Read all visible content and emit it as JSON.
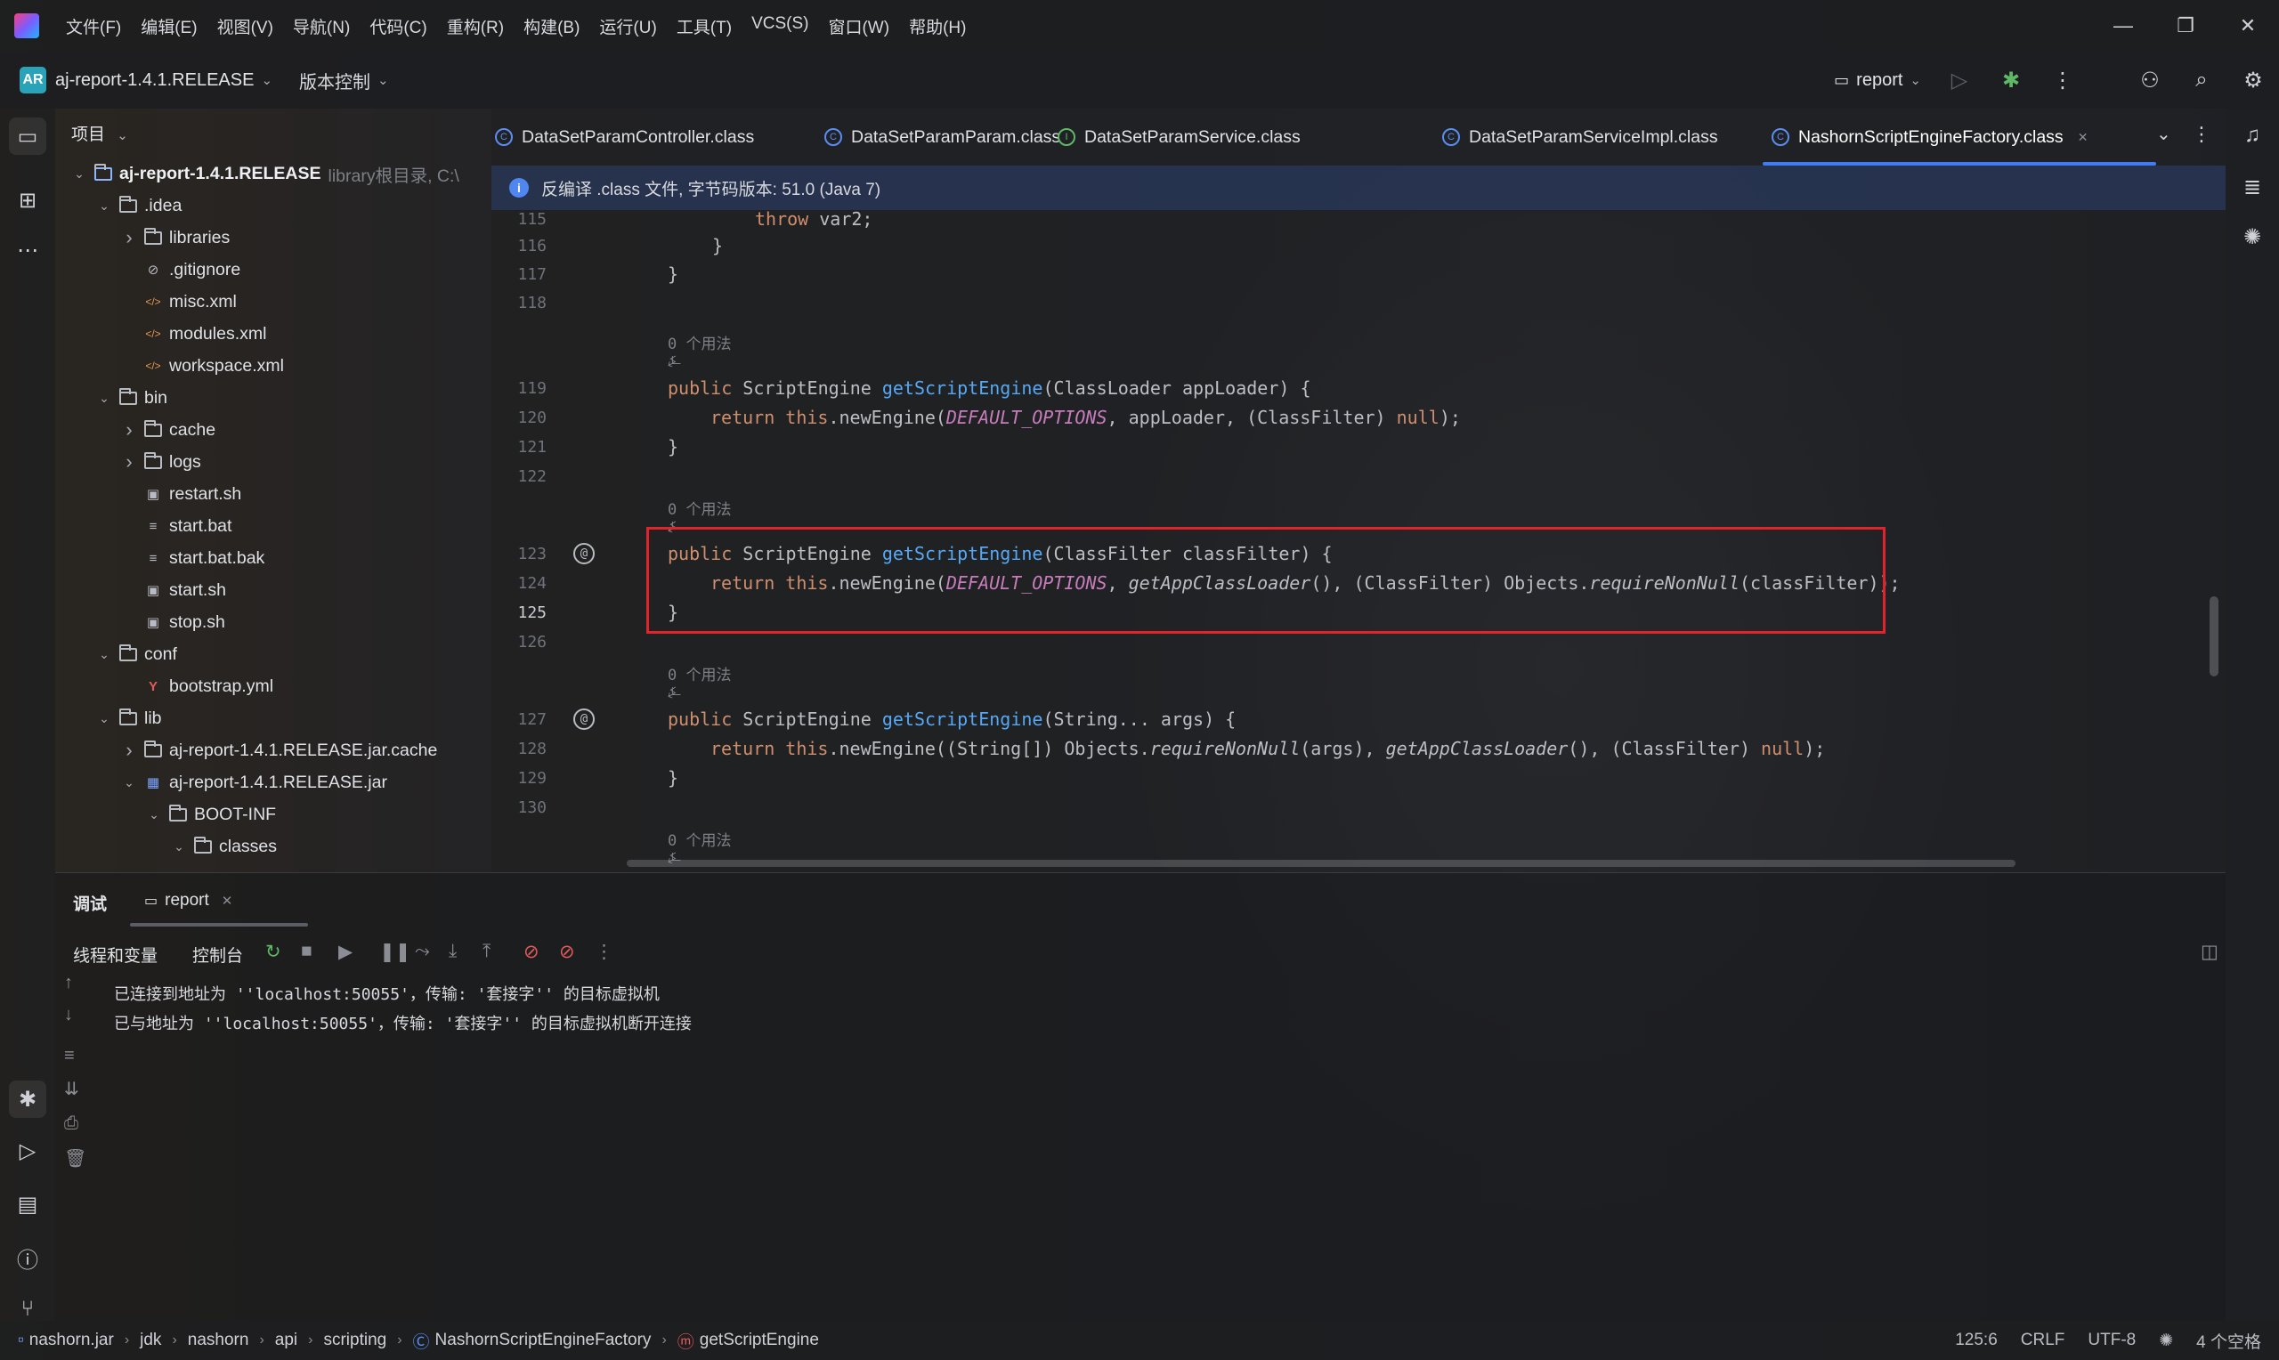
{
  "menu": [
    "文件(F)",
    "编辑(E)",
    "视图(V)",
    "导航(N)",
    "代码(C)",
    "重构(R)",
    "构建(B)",
    "运行(U)",
    "工具(T)",
    "VCS(S)",
    "窗口(W)",
    "帮助(H)"
  ],
  "toolbar": {
    "project_badge": "AR",
    "project_name": "aj-report-1.4.1.RELEASE",
    "vcs_label": "版本控制",
    "run_config": "report"
  },
  "project_panel": {
    "header": "项目",
    "tree": [
      {
        "label": "aj-report-1.4.1.RELEASE",
        "hint": "library根目录, C:\\",
        "arrow": "v",
        "icon": "module",
        "depth": 0,
        "bold": true
      },
      {
        "label": ".idea",
        "arrow": "v",
        "icon": "folder",
        "depth": 1
      },
      {
        "label": "libraries",
        "arrow": ">",
        "icon": "folder",
        "depth": 2
      },
      {
        "label": ".gitignore",
        "arrow": "",
        "icon": "ignore",
        "depth": 2
      },
      {
        "label": "misc.xml",
        "arrow": "",
        "icon": "xml",
        "depth": 2
      },
      {
        "label": "modules.xml",
        "arrow": "",
        "icon": "xml",
        "depth": 2
      },
      {
        "label": "workspace.xml",
        "arrow": "",
        "icon": "xml",
        "depth": 2
      },
      {
        "label": "bin",
        "arrow": "v",
        "icon": "folder",
        "depth": 1
      },
      {
        "label": "cache",
        "arrow": ">",
        "icon": "folder",
        "depth": 2
      },
      {
        "label": "logs",
        "arrow": ">",
        "icon": "folder",
        "depth": 2
      },
      {
        "label": "restart.sh",
        "arrow": "",
        "icon": "shell",
        "depth": 2
      },
      {
        "label": "start.bat",
        "arrow": "",
        "icon": "text",
        "depth": 2
      },
      {
        "label": "start.bat.bak",
        "arrow": "",
        "icon": "text",
        "depth": 2
      },
      {
        "label": "start.sh",
        "arrow": "",
        "icon": "shell",
        "depth": 2
      },
      {
        "label": "stop.sh",
        "arrow": "",
        "icon": "shell",
        "depth": 2
      },
      {
        "label": "conf",
        "arrow": "v",
        "icon": "folder",
        "depth": 1
      },
      {
        "label": "bootstrap.yml",
        "arrow": "",
        "icon": "yaml",
        "depth": 2
      },
      {
        "label": "lib",
        "arrow": "v",
        "icon": "folder",
        "depth": 1
      },
      {
        "label": "aj-report-1.4.1.RELEASE.jar.cache",
        "arrow": ">",
        "icon": "folder",
        "depth": 2
      },
      {
        "label": "aj-report-1.4.1.RELEASE.jar",
        "arrow": "v",
        "icon": "jar",
        "depth": 2
      },
      {
        "label": "BOOT-INF",
        "arrow": "v",
        "icon": "folder",
        "depth": 3
      },
      {
        "label": "classes",
        "arrow": "v",
        "icon": "folder",
        "depth": 4
      }
    ]
  },
  "tabs": [
    {
      "label": "DataSetParamController.class",
      "icon": "class",
      "active": false
    },
    {
      "label": "DataSetParamParam.class",
      "icon": "class",
      "active": false
    },
    {
      "label": "DataSetParamService.class",
      "icon": "interface",
      "active": false
    },
    {
      "label": "DataSetParamServiceImpl.class",
      "icon": "class",
      "active": false
    },
    {
      "label": "NashornScriptEngineFactory.class",
      "icon": "class",
      "active": true
    }
  ],
  "info_bar": "反编译 .class 文件, 字节码版本: 51.0 (Java 7)",
  "code": {
    "usage_hint": "0 个用法",
    "author_hint": "⍼",
    "line_numbers": [
      "115",
      "116",
      "117",
      "118",
      "119",
      "120",
      "121",
      "122",
      "123",
      "124",
      "125",
      "126",
      "127",
      "128",
      "129",
      "130"
    ],
    "current_line": "125"
  },
  "debug": {
    "title": "调试",
    "tab": "report",
    "sub_tabs": [
      "线程和变量",
      "控制台"
    ],
    "console": [
      "已连接到地址为 ''localhost:50055'，传输: '套接字'' 的目标虚拟机",
      "已与地址为 ''localhost:50055'，传输: '套接字'' 的目标虚拟机断开连接"
    ]
  },
  "statusbar": {
    "breadcrumb": [
      "nashorn.jar",
      "jdk",
      "nashorn",
      "api",
      "scripting",
      "NashornScriptEngineFactory",
      "getScriptEngine"
    ],
    "position": "125:6",
    "line_sep": "CRLF",
    "encoding": "UTF-8",
    "indent": "4 个空格"
  },
  "colors": {
    "keyword": "#cf8e6d",
    "function": "#56a8f5",
    "constant": "#c77dbb",
    "accent": "#3f7cf6",
    "highlight_box": "#e0242b"
  }
}
